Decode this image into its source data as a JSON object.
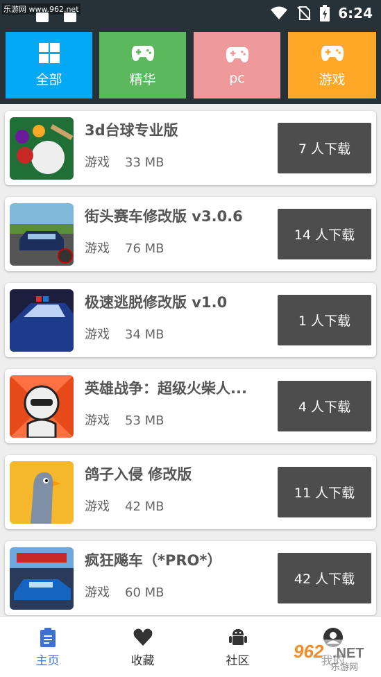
{
  "status_bar": {
    "watermark": "乐游网 www.962.net",
    "time": "6:24"
  },
  "categories": [
    {
      "label": "全部",
      "icon": "grid-icon",
      "color": "#03a9f4"
    },
    {
      "label": "精华",
      "icon": "gamepad-icon",
      "color": "#5cb85c"
    },
    {
      "label": "pc",
      "icon": "gamepad-icon",
      "color": "#ef9a9a"
    },
    {
      "label": "游戏",
      "icon": "gamepad-icon",
      "color": "#ffa726"
    }
  ],
  "apps": [
    {
      "title": "3d台球专业版",
      "category": "游戏",
      "size": "33 MB",
      "downloads": "7 人下载"
    },
    {
      "title": "街头赛车修改版 v3.0.6",
      "category": "游戏",
      "size": "76 MB",
      "downloads": "14 人下载"
    },
    {
      "title": "极速逃脱修改版 v1.0",
      "category": "游戏",
      "size": "34 MB",
      "downloads": "1 人下载"
    },
    {
      "title": "英雄战争：超级火柴人...",
      "category": "游戏",
      "size": "53 MB",
      "downloads": "4 人下载"
    },
    {
      "title": "鸽子入侵 修改版",
      "category": "游戏",
      "size": "42 MB",
      "downloads": "11 人下载"
    },
    {
      "title": "疯狂飚车（*PRO*）",
      "category": "游戏",
      "size": "60 MB",
      "downloads": "42 人下载"
    }
  ],
  "bottom_nav": [
    {
      "label": "主页",
      "icon": "clipboard-icon",
      "active": true
    },
    {
      "label": "收藏",
      "icon": "heart-icon",
      "active": false
    },
    {
      "label": "社区",
      "icon": "android-icon",
      "active": false
    },
    {
      "label": "我的",
      "icon": "user-icon",
      "active": false
    }
  ],
  "watermark_bottom": "962.NET 乐游网",
  "colors": {
    "header": "#263238",
    "download_button": "#4d4d4d",
    "active_nav": "#3f6fd0"
  }
}
